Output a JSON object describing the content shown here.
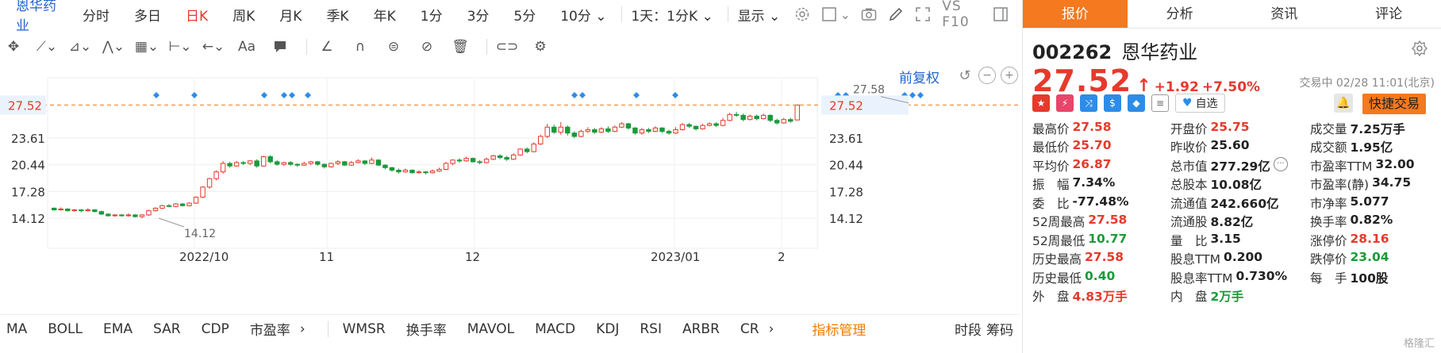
{
  "stock": {
    "name": "恩华药业",
    "code": "002262"
  },
  "periods": [
    "分时",
    "多日",
    "日K",
    "周K",
    "月K",
    "季K",
    "年K",
    "1分",
    "3分",
    "5分",
    "10分"
  ],
  "active_period": "日K",
  "dropdowns": {
    "tenday": "10分",
    "day_interval": "1天：1分K",
    "display": "显示"
  },
  "vs_label": "VS F10",
  "fq_label": "前复权",
  "indicators": [
    "MA",
    "BOLL",
    "EMA",
    "SAR",
    "CDP",
    "市盈率",
    "WMSR",
    "换手率",
    "MAVOL",
    "MACD",
    "KDJ",
    "RSI",
    "ARBR",
    "CR"
  ],
  "indicator_manager": "指标管理",
  "bottom_right": [
    "时段",
    "筹码"
  ],
  "tabs": [
    "报价",
    "分析",
    "资讯",
    "评论"
  ],
  "quote": {
    "price": "27.52",
    "arrow": "↑",
    "change": "+1.92",
    "change_pct": "+7.50%",
    "status": "交易中 02/28 11:01(北京)",
    "fav_label": "自选",
    "trade_label": "快捷交易"
  },
  "stats": [
    [
      {
        "l": "最高价",
        "v": "27.58",
        "c": "red"
      },
      {
        "l": "开盘价",
        "v": "25.75",
        "c": "red"
      },
      {
        "l": "成交量",
        "v": "7.25万手",
        "c": ""
      }
    ],
    [
      {
        "l": "最低价",
        "v": "25.70",
        "c": "red"
      },
      {
        "l": "昨收价",
        "v": "25.60",
        "c": ""
      },
      {
        "l": "成交额",
        "v": "1.95亿",
        "c": ""
      }
    ],
    [
      {
        "l": "平均价",
        "v": "26.87",
        "c": "red"
      },
      {
        "l": "总市值",
        "v": "277.29亿",
        "c": "",
        "dots": true
      },
      {
        "l": "市盈率TTM",
        "v": "32.00",
        "c": ""
      }
    ],
    [
      {
        "l": "振　幅",
        "v": "7.34%",
        "c": ""
      },
      {
        "l": "总股本",
        "v": "10.08亿",
        "c": ""
      },
      {
        "l": "市盈率(静)",
        "v": "34.75",
        "c": ""
      }
    ],
    [
      {
        "l": "委　比",
        "v": "-77.48%",
        "c": ""
      },
      {
        "l": "流通值",
        "v": "242.660亿",
        "c": ""
      },
      {
        "l": "市净率",
        "v": "5.077",
        "c": ""
      }
    ],
    [
      {
        "l": "52周最高",
        "v": "27.58",
        "c": "red"
      },
      {
        "l": "流通股",
        "v": "8.82亿",
        "c": ""
      },
      {
        "l": "换手率",
        "v": "0.82%",
        "c": ""
      }
    ],
    [
      {
        "l": "52周最低",
        "v": "10.77",
        "c": "green"
      },
      {
        "l": "量　比",
        "v": "3.15",
        "c": ""
      },
      {
        "l": "涨停价",
        "v": "28.16",
        "c": "red"
      }
    ],
    [
      {
        "l": "历史最高",
        "v": "27.58",
        "c": "red"
      },
      {
        "l": "股息TTM",
        "v": "0.200",
        "c": ""
      },
      {
        "l": "跌停价",
        "v": "23.04",
        "c": "green"
      }
    ],
    [
      {
        "l": "历史最低",
        "v": "0.40",
        "c": "green"
      },
      {
        "l": "股息率TTM",
        "v": "0.730%",
        "c": ""
      },
      {
        "l": "每　手",
        "v": "100股",
        "c": ""
      }
    ],
    [
      {
        "l": "外　盘",
        "v": "4.83万手",
        "c": "red"
      },
      {
        "l": "内　盘",
        "v": "2万手",
        "c": "green"
      }
    ]
  ],
  "watermark": "格隆汇",
  "chart_data": {
    "type": "candlestick",
    "y_ticks": [
      "23.61",
      "20.44",
      "17.28",
      "14.12"
    ],
    "y_ticks_values": [
      23.61,
      20.44,
      17.28,
      14.12
    ],
    "current_price": 27.52,
    "current_price_label": "27.52",
    "x_labels": [
      "2022/10",
      "11",
      "12",
      "2023/01",
      "2"
    ],
    "high_annotation": "27.58",
    "low_annotation": "14.12",
    "candles": [
      [
        15.3,
        15.1,
        15.4,
        15.0
      ],
      [
        15.1,
        15.2,
        15.4,
        15.0
      ],
      [
        15.2,
        15.0,
        15.3,
        14.9
      ],
      [
        15.0,
        15.1,
        15.2,
        14.9
      ],
      [
        15.1,
        15.0,
        15.2,
        14.8
      ],
      [
        15.0,
        15.1,
        15.3,
        14.9
      ],
      [
        15.1,
        14.9,
        15.2,
        14.8
      ],
      [
        14.9,
        14.6,
        15.0,
        14.5
      ],
      [
        14.6,
        14.4,
        14.7,
        14.3
      ],
      [
        14.4,
        14.5,
        14.6,
        14.3
      ],
      [
        14.5,
        14.4,
        14.6,
        14.3
      ],
      [
        14.4,
        14.5,
        14.7,
        14.3
      ],
      [
        14.5,
        14.3,
        14.6,
        14.2
      ],
      [
        14.3,
        14.5,
        14.6,
        14.1
      ],
      [
        14.5,
        15.0,
        15.1,
        14.4
      ],
      [
        15.0,
        15.3,
        15.4,
        14.9
      ],
      [
        15.3,
        15.6,
        15.7,
        15.2
      ],
      [
        15.6,
        15.5,
        15.8,
        15.4
      ],
      [
        15.5,
        15.8,
        15.9,
        15.4
      ],
      [
        15.8,
        15.6,
        15.9,
        15.5
      ],
      [
        15.6,
        15.9,
        16.0,
        15.5
      ],
      [
        15.9,
        16.6,
        16.7,
        15.8
      ],
      [
        16.6,
        17.8,
        17.9,
        16.5
      ],
      [
        17.8,
        18.8,
        18.9,
        17.6
      ],
      [
        18.8,
        19.6,
        19.8,
        18.6
      ],
      [
        19.6,
        20.6,
        20.9,
        19.4
      ],
      [
        20.6,
        20.3,
        20.8,
        20.1
      ],
      [
        20.3,
        20.7,
        20.9,
        20.2
      ],
      [
        20.7,
        20.6,
        20.9,
        20.4
      ],
      [
        20.6,
        20.9,
        21.0,
        20.4
      ],
      [
        20.9,
        20.3,
        21.1,
        20.1
      ],
      [
        20.3,
        21.4,
        21.5,
        20.2
      ],
      [
        21.4,
        20.8,
        21.6,
        20.6
      ],
      [
        20.8,
        20.5,
        21.0,
        20.3
      ],
      [
        20.5,
        20.7,
        20.8,
        20.3
      ],
      [
        20.7,
        20.5,
        20.9,
        20.3
      ],
      [
        20.5,
        20.4,
        20.6,
        20.2
      ],
      [
        20.4,
        20.6,
        20.8,
        20.3
      ],
      [
        20.6,
        20.8,
        20.9,
        20.4
      ],
      [
        20.8,
        20.5,
        20.9,
        20.3
      ],
      [
        20.5,
        20.2,
        20.6,
        20.0
      ],
      [
        20.2,
        20.6,
        20.7,
        20.1
      ],
      [
        20.6,
        20.8,
        21.0,
        20.4
      ],
      [
        20.8,
        20.4,
        20.9,
        20.3
      ],
      [
        20.4,
        20.7,
        20.9,
        20.3
      ],
      [
        20.7,
        20.9,
        21.1,
        20.6
      ],
      [
        20.9,
        20.6,
        21.0,
        20.4
      ],
      [
        20.6,
        21.0,
        21.3,
        20.5
      ],
      [
        21.0,
        20.4,
        21.1,
        20.3
      ],
      [
        20.4,
        20.1,
        20.5,
        19.9
      ],
      [
        20.1,
        19.8,
        20.2,
        19.6
      ],
      [
        19.8,
        19.6,
        20.0,
        19.4
      ],
      [
        19.6,
        19.8,
        20.0,
        19.5
      ],
      [
        19.8,
        19.5,
        19.9,
        19.4
      ],
      [
        19.5,
        19.6,
        19.8,
        19.4
      ],
      [
        19.6,
        19.5,
        19.7,
        19.3
      ],
      [
        19.5,
        19.7,
        19.9,
        19.4
      ],
      [
        19.7,
        19.9,
        20.1,
        19.6
      ],
      [
        19.9,
        20.6,
        20.8,
        19.8
      ],
      [
        20.6,
        21.0,
        21.1,
        20.4
      ],
      [
        21.0,
        20.9,
        21.2,
        20.7
      ],
      [
        20.9,
        21.2,
        21.4,
        20.8
      ],
      [
        21.2,
        20.8,
        21.3,
        20.7
      ],
      [
        20.8,
        20.7,
        21.0,
        20.5
      ],
      [
        20.7,
        21.1,
        21.3,
        20.6
      ],
      [
        21.1,
        21.5,
        21.6,
        21.0
      ],
      [
        21.5,
        21.3,
        21.7,
        21.1
      ],
      [
        21.3,
        21.1,
        21.5,
        20.9
      ],
      [
        21.1,
        21.6,
        21.8,
        21.0
      ],
      [
        21.6,
        22.3,
        22.4,
        21.5
      ],
      [
        22.3,
        22.0,
        22.5,
        21.8
      ],
      [
        22.0,
        22.9,
        23.1,
        21.9
      ],
      [
        22.9,
        23.8,
        24.0,
        22.8
      ],
      [
        23.8,
        24.9,
        25.3,
        23.6
      ],
      [
        24.9,
        24.3,
        25.2,
        24.1
      ],
      [
        24.3,
        24.9,
        25.5,
        24.0
      ],
      [
        24.9,
        24.2,
        25.1,
        23.9
      ],
      [
        24.2,
        23.8,
        24.4,
        23.6
      ],
      [
        23.8,
        24.4,
        24.6,
        23.7
      ],
      [
        24.4,
        24.6,
        24.9,
        24.2
      ],
      [
        24.6,
        24.3,
        24.8,
        24.1
      ],
      [
        24.3,
        24.7,
        24.9,
        24.2
      ],
      [
        24.7,
        24.4,
        25.0,
        24.2
      ],
      [
        24.4,
        24.9,
        25.1,
        24.3
      ],
      [
        24.9,
        25.3,
        25.5,
        24.8
      ],
      [
        25.3,
        24.8,
        25.4,
        24.6
      ],
      [
        24.8,
        24.2,
        24.9,
        24.0
      ],
      [
        24.2,
        24.6,
        24.8,
        24.0
      ],
      [
        24.6,
        24.4,
        24.8,
        24.2
      ],
      [
        24.4,
        24.8,
        25.0,
        24.3
      ],
      [
        24.8,
        24.4,
        24.9,
        24.2
      ],
      [
        24.4,
        24.2,
        24.6,
        24.0
      ],
      [
        24.2,
        24.6,
        24.9,
        24.1
      ],
      [
        24.6,
        25.2,
        25.4,
        24.5
      ],
      [
        25.2,
        25.0,
        25.4,
        24.8
      ],
      [
        25.0,
        24.7,
        25.1,
        24.5
      ],
      [
        24.7,
        25.1,
        25.3,
        24.6
      ],
      [
        25.1,
        25.3,
        25.5,
        25.0
      ],
      [
        25.3,
        25.1,
        25.5,
        24.9
      ],
      [
        25.1,
        25.7,
        26.0,
        25.0
      ],
      [
        25.7,
        26.4,
        26.6,
        25.6
      ],
      [
        26.4,
        26.3,
        26.7,
        26.1
      ],
      [
        26.3,
        25.8,
        26.5,
        25.6
      ],
      [
        25.8,
        26.2,
        26.4,
        25.7
      ],
      [
        26.2,
        25.9,
        26.4,
        25.7
      ],
      [
        25.9,
        26.3,
        26.5,
        25.8
      ],
      [
        26.3,
        25.7,
        26.4,
        25.5
      ],
      [
        25.7,
        25.4,
        25.9,
        25.2
      ],
      [
        25.4,
        25.8,
        26.0,
        25.3
      ],
      [
        25.8,
        25.6,
        26.0,
        25.4
      ],
      [
        25.75,
        27.52,
        27.58,
        25.7
      ]
    ]
  }
}
